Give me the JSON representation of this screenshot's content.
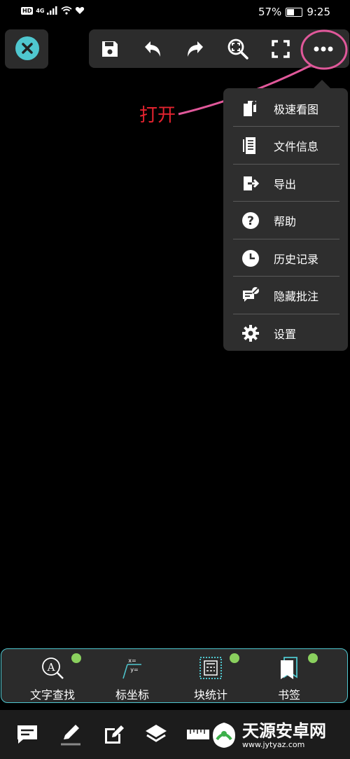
{
  "status_bar": {
    "network": "HD",
    "signal": "4G",
    "battery": "57%",
    "battery_level": 0.57,
    "time": "9:25"
  },
  "toolbar": {
    "buttons": [
      "close-icon",
      "save-icon",
      "undo-icon",
      "redo-icon",
      "zoom-fit-icon",
      "fullscreen-icon",
      "more-icon"
    ]
  },
  "annotation": {
    "text": "打开",
    "color": "#e3232f",
    "highlight_color": "#e0589a"
  },
  "menu": {
    "items": [
      {
        "label": "极速看图",
        "icon": "fast-view-icon"
      },
      {
        "label": "文件信息",
        "icon": "file-info-icon"
      },
      {
        "label": "导出",
        "icon": "export-icon"
      },
      {
        "label": "帮助",
        "icon": "help-icon"
      },
      {
        "label": "历史记录",
        "icon": "history-icon"
      },
      {
        "label": "隐藏批注",
        "icon": "hide-annotation-icon"
      },
      {
        "label": "设置",
        "icon": "settings-icon"
      }
    ]
  },
  "feature_bar": {
    "accent": "#4fc7cf",
    "items": [
      {
        "label": "文字查找",
        "icon": "text-search-icon",
        "badge": true
      },
      {
        "label": "标坐标",
        "icon": "coordinate-icon",
        "badge": false
      },
      {
        "label": "块统计",
        "icon": "block-stats-icon",
        "badge": true
      },
      {
        "label": "书签",
        "icon": "bookmark-icon",
        "badge": true
      }
    ]
  },
  "bottom_nav": {
    "buttons": [
      "comment-icon",
      "pen-icon",
      "edit-icon",
      "layers-icon",
      "ruler-icon"
    ]
  },
  "watermark": {
    "title": "天源安卓网",
    "url": "www.jytyaz.com"
  }
}
